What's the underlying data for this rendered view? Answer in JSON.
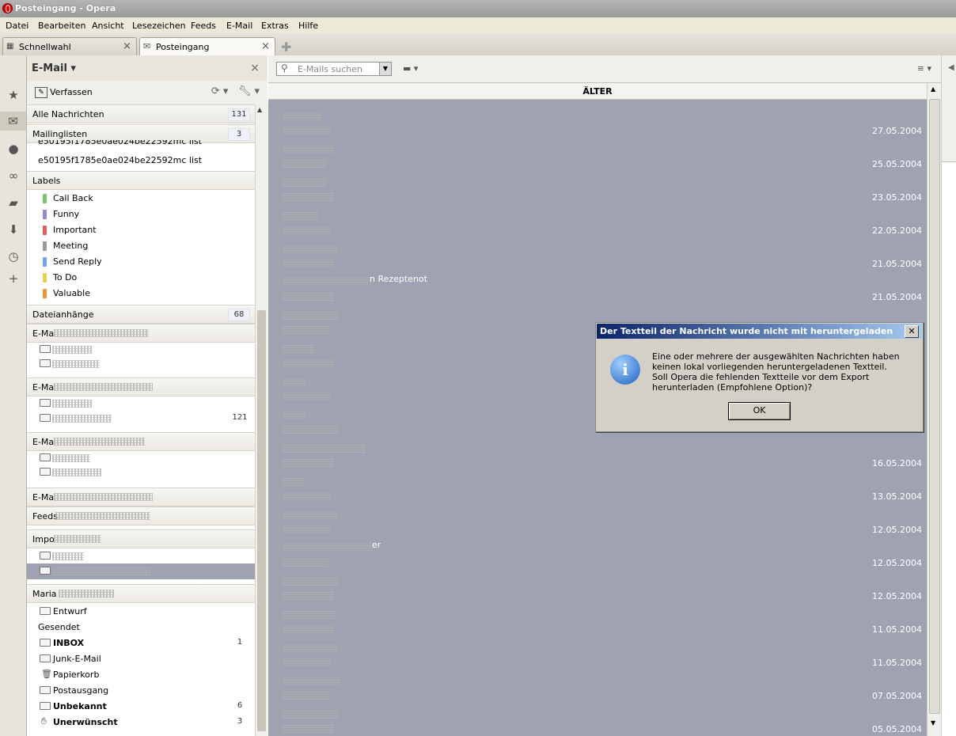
{
  "window": {
    "title": "Posteingang - Opera"
  },
  "menu": [
    "Datei",
    "Bearbeiten",
    "Ansicht",
    "Lesezeichen",
    "Feeds",
    "E-Mail",
    "Extras",
    "Hilfe"
  ],
  "tabs": [
    {
      "label": "Schnellwahl",
      "close": "×"
    },
    {
      "label": "Posteingang",
      "close": "×"
    }
  ],
  "panel": {
    "title": "E-Mail ▾",
    "close": "×",
    "compose_label": "Verfassen",
    "rows": {
      "all_messages": {
        "label": "Alle Nachrichten",
        "count": "131"
      },
      "mailinglists": {
        "label": "Mailinglisten",
        "count": "3"
      },
      "list1": "e50195f1785e0ae024be22592mc list",
      "list2": "e50195f1785e0ae024be22592mc list",
      "labels_header": "Labels",
      "labels": [
        {
          "label": "Call Back",
          "color": "#7ec46a"
        },
        {
          "label": "Funny",
          "color": "#9a86d6"
        },
        {
          "label": "Important",
          "color": "#e0605a"
        },
        {
          "label": "Meeting",
          "color": "#9a9a9a"
        },
        {
          "label": "Send Reply",
          "color": "#6fa6e4"
        },
        {
          "label": "To Do",
          "color": "#e6d24a"
        },
        {
          "label": "Valuable",
          "color": "#e8983a"
        }
      ],
      "attachments": {
        "label": "Dateianhänge",
        "count": "68"
      },
      "acct1": "E-Ma",
      "acct2": "E-Ma",
      "acct2_count": "121",
      "acct3": "E-Ma",
      "acct4": "E-Ma",
      "feeds": "Feeds",
      "imap": "Impo",
      "maria": "Maria",
      "folders": [
        {
          "label": "Entwurf",
          "count": "",
          "bold": false
        },
        {
          "label": "Gesendet",
          "count": "",
          "bold": false
        },
        {
          "label": "INBOX",
          "count": "1",
          "bold": true
        },
        {
          "label": "Junk-E-Mail",
          "count": "",
          "bold": false
        },
        {
          "label": "Papierkorb",
          "count": "",
          "bold": false
        },
        {
          "label": "Postausgang",
          "count": "",
          "bold": false
        },
        {
          "label": "Unbekannt",
          "count": "6",
          "bold": true
        },
        {
          "label": "Unerwünscht",
          "count": "3",
          "bold": true
        }
      ]
    }
  },
  "toolbar": {
    "search_placeholder": "E-Mails suchen"
  },
  "message_list": {
    "group_header": "ÄLTER",
    "messages": [
      {
        "date": "27.05.2004",
        "partial": ""
      },
      {
        "date": "25.05.2004",
        "partial": ""
      },
      {
        "date": "23.05.2004",
        "partial": ""
      },
      {
        "date": "22.05.2004",
        "partial": ""
      },
      {
        "date": "21.05.2004",
        "partial": ""
      },
      {
        "date": "21.05.2004",
        "partial": "n Rezeptenot"
      },
      {
        "date": "",
        "partial": ""
      },
      {
        "date": "",
        "partial": ""
      },
      {
        "date": "",
        "partial": ""
      },
      {
        "date": "",
        "partial": ""
      },
      {
        "date": "16.05.2004",
        "partial": ""
      },
      {
        "date": "13.05.2004",
        "partial": ""
      },
      {
        "date": "12.05.2004",
        "partial": ""
      },
      {
        "date": "12.05.2004",
        "partial": "er"
      },
      {
        "date": "12.05.2004",
        "partial": ""
      },
      {
        "date": "11.05.2004",
        "partial": ""
      },
      {
        "date": "11.05.2004",
        "partial": ""
      },
      {
        "date": "07.05.2004",
        "partial": ""
      },
      {
        "date": "05.05.2004",
        "partial": ""
      }
    ]
  },
  "dialog": {
    "title": "Der Textteil der Nachricht wurde nicht mit heruntergeladen",
    "message": "Eine oder mehrere der ausgewählten Nachrichten haben keinen lokal vorliegenden heruntergeladenen Textteil. Soll Opera die fehlenden Textteile vor dem Export herunterladen (Empfohlene Option)?",
    "ok_label": "OK",
    "close": "✕"
  }
}
